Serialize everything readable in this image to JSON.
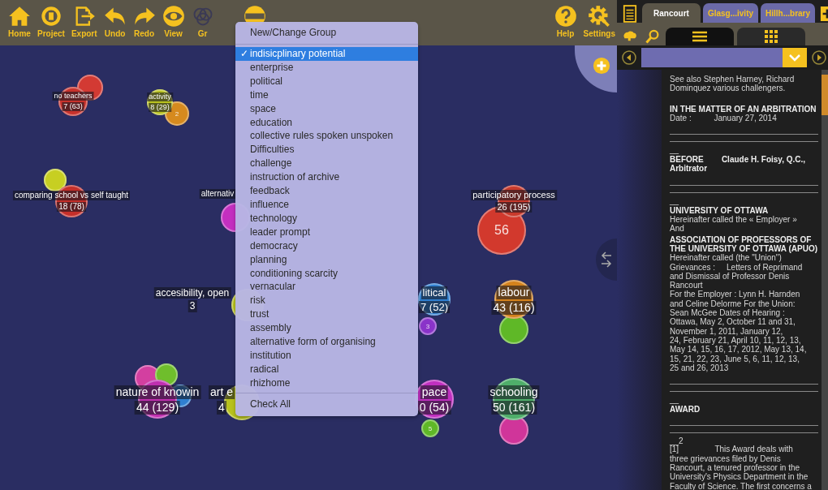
{
  "toolbar": {
    "items": [
      {
        "label": "Home"
      },
      {
        "label": "Project"
      },
      {
        "label": "Export"
      },
      {
        "label": "Undo"
      },
      {
        "label": "Redo"
      },
      {
        "label": "View"
      },
      {
        "label": "Gr"
      }
    ],
    "right_items": [
      {
        "label": "Help"
      },
      {
        "label": "Settings"
      }
    ]
  },
  "canvas": {
    "nodes": [
      {
        "label": "no teachers",
        "count": "7 (63)",
        "color": "#c8322c",
        "satellites": [
          {
            "color": "#d33a33"
          }
        ]
      },
      {
        "label": "activity",
        "count": "8 (29)",
        "color": "#b9c21f",
        "satellites": [
          {
            "color": "#d68a1e",
            "count": "2"
          }
        ]
      },
      {
        "label": "comparing school vs self taught",
        "count": "18 (78)",
        "color": "#c52f2a",
        "satellites": [
          {
            "color": "#c7cf22"
          }
        ]
      },
      {
        "label": "alternativ",
        "color": "#c42fc0"
      },
      {
        "label": "participatory process",
        "count": "26 (195)",
        "color": "#c93a2c",
        "satellites": [
          {
            "color": "#d2392d",
            "count": "56"
          }
        ]
      },
      {
        "label": "accesibility, open",
        "count": "3",
        "color": "#b8c21d"
      },
      {
        "label": "litical",
        "count": "7 (52)",
        "color": "#2f7fd0",
        "satellites": [
          {
            "color": "#8a33c9",
            "count": "3"
          }
        ]
      },
      {
        "label": "labour",
        "count": "43 (116)",
        "color": "#d4821c",
        "satellites": [
          {
            "color": "#5fb827"
          }
        ]
      },
      {
        "label": "nature of knowin",
        "count": "44 (129)",
        "color": "#c02fb0",
        "satellites": [
          {
            "color": "#d33fa0"
          },
          {
            "color": "#6fbe2c"
          },
          {
            "color": "#2f7fd0"
          }
        ]
      },
      {
        "label": "art e",
        "count": "4",
        "color": "#b8c21d"
      },
      {
        "label": "pace",
        "count": "0 (54)",
        "color": "#c02fc0",
        "satellites": [
          {
            "color": "#5fb827",
            "count": "5"
          }
        ]
      },
      {
        "label": "schooling",
        "count": "50 (161)",
        "color": "#4fae6a",
        "satellites": [
          {
            "color": "#d0359a"
          }
        ]
      }
    ]
  },
  "group_menu": {
    "header": "New/Change Group",
    "check_mark": "✓",
    "items": [
      {
        "label": "indisicplinary potential",
        "checked": true,
        "selected": true
      },
      {
        "label": "enterprise",
        "checked": false,
        "selected": false
      },
      {
        "label": "political",
        "checked": false,
        "selected": false
      },
      {
        "label": "time",
        "checked": false,
        "selected": false
      },
      {
        "label": "space",
        "checked": false,
        "selected": false
      },
      {
        "label": "education",
        "checked": false,
        "selected": false
      },
      {
        "label": "collective rules spoken unspoken",
        "checked": false,
        "selected": false
      },
      {
        "label": "Difficulties",
        "checked": false,
        "selected": false
      },
      {
        "label": "challenge",
        "checked": false,
        "selected": false
      },
      {
        "label": "instruction of archive",
        "checked": false,
        "selected": false
      },
      {
        "label": "feedback",
        "checked": false,
        "selected": false
      },
      {
        "label": "influence",
        "checked": false,
        "selected": false
      },
      {
        "label": "technology",
        "checked": false,
        "selected": false
      },
      {
        "label": "leader prompt",
        "checked": false,
        "selected": false
      },
      {
        "label": "democracy",
        "checked": false,
        "selected": false
      },
      {
        "label": "planning",
        "checked": false,
        "selected": false
      },
      {
        "label": "conditioning scarcity",
        "checked": false,
        "selected": false
      },
      {
        "label": "vernacular",
        "checked": false,
        "selected": false
      },
      {
        "label": "risk",
        "checked": false,
        "selected": false
      },
      {
        "label": "trust",
        "checked": false,
        "selected": false
      },
      {
        "label": "assembly",
        "checked": false,
        "selected": false
      },
      {
        "label": "alternative form of organising",
        "checked": false,
        "selected": false
      },
      {
        "label": "institution",
        "checked": false,
        "selected": false
      },
      {
        "label": "radical",
        "checked": false,
        "selected": false
      },
      {
        "label": "rhizhome",
        "checked": false,
        "selected": false
      }
    ],
    "footer": "Check All"
  },
  "document_panel": {
    "tabs": [
      {
        "label": "Rancourt",
        "selected": true
      },
      {
        "label": "Glasg...ivity",
        "selected": false
      },
      {
        "label": "Hillh...brary",
        "selected": false
      }
    ],
    "view_tabs": [
      {
        "selected": true
      },
      {
        "selected": false
      }
    ],
    "blocks": [
      {
        "kind": "text",
        "text": "See also Stephen Harney, Richard\nDominquez various challengers."
      },
      {
        "kind": "gap"
      },
      {
        "kind": "bold",
        "text": "IN THE MATTER OF AN ARBITRATION"
      },
      {
        "kind": "text",
        "text": "Date :          January 27, 2014"
      },
      {
        "kind": "rules"
      },
      {
        "kind": "mark",
        "text": "__"
      },
      {
        "kind": "bold",
        "text": "BEFORE        Claude H. Foisy, Q.C.,\nArbitrator"
      },
      {
        "kind": "rules"
      },
      {
        "kind": "mark",
        "text": "__"
      },
      {
        "kind": "bold",
        "text": "UNIVERSITY OF OTTAWA"
      },
      {
        "kind": "text",
        "text": "Hereinafter called the « Employer »\nAnd"
      },
      {
        "kind": "bold",
        "text": "ASSOCIATION OF PROFESSORS OF\nTHE UNIVERSITY OF OTTAWA (APUO)"
      },
      {
        "kind": "text",
        "text": "Hereinafter called (the \"Union\")\nGrievances :     Letters of Reprimand\nand Dismissal of Professor Denis\nRancourt\nFor the Employer : Lynn H. Harnden\nand Celine Delorme For the Union:\nSean McGee Dates of Hearing :\nOttawa, May 2, October 11 and 31,\nNovember 1, 2011, January 12,\n24, February 21, April 10, 11, 12, 13,\nMay 14, 15, 16, 17, 2012, May 13, 14,\n15, 21, 22, 23, June 5, 6, 11, 12, 13,\n25 and 26, 2013"
      },
      {
        "kind": "rules"
      },
      {
        "kind": "mark",
        "text": "__"
      },
      {
        "kind": "bold",
        "text": "AWARD"
      },
      {
        "kind": "rules"
      },
      {
        "kind": "mark",
        "text": "__2"
      },
      {
        "kind": "text",
        "text": "[1]                This Award deals with\nthree grievances filed by Denis\nRancourt, a tenured professor in the\nUniversity's Physics Department in the\nFaculty of Science. The first concerns a"
      }
    ]
  }
}
